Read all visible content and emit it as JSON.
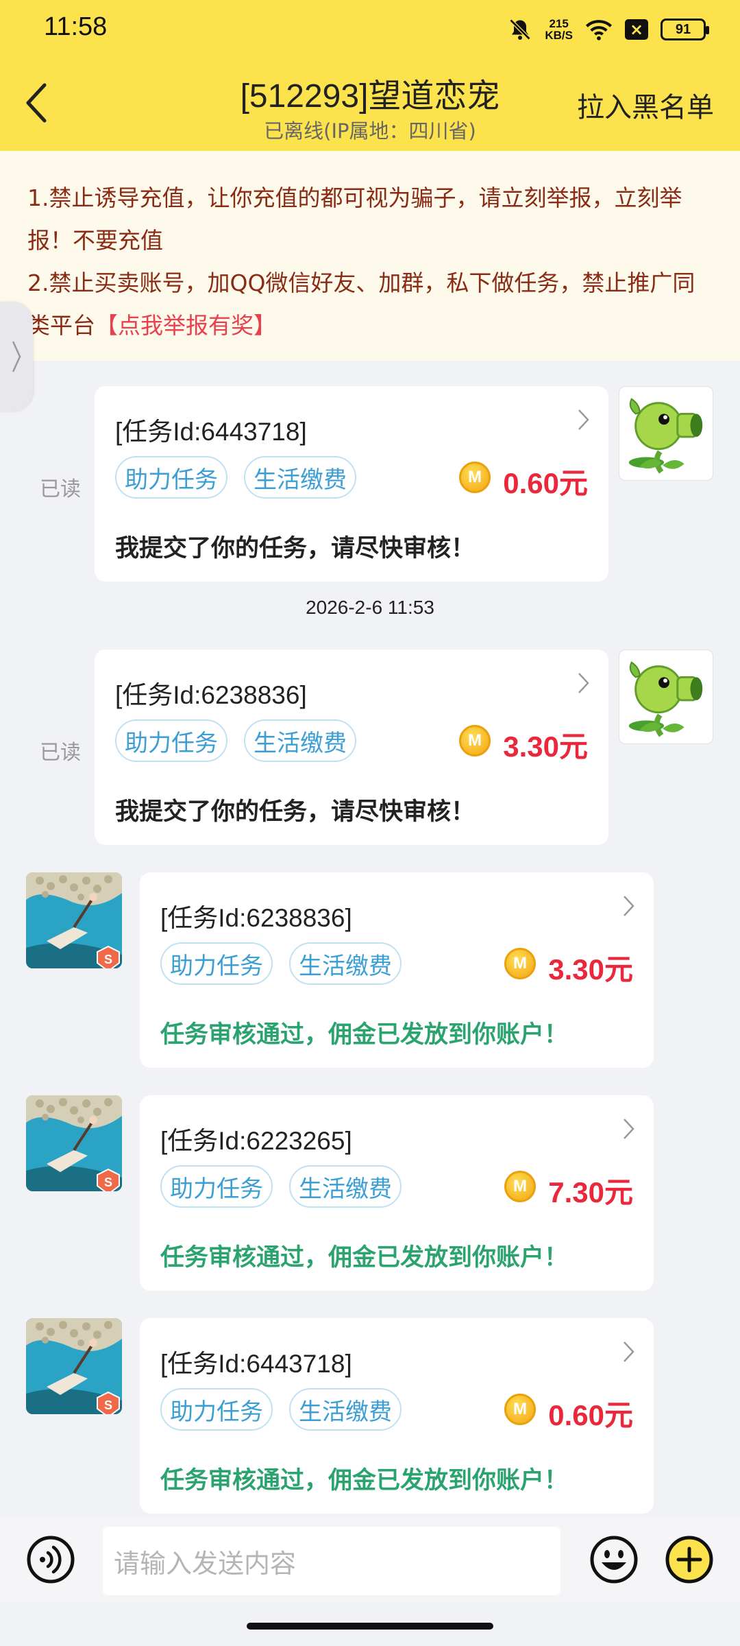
{
  "status_bar": {
    "time": "11:58",
    "net_speed": "215",
    "net_unit": "KB/S",
    "battery": "91"
  },
  "header": {
    "title": "[512293]望道恋宠",
    "subtitle": "已离线(IP属地：四川省)",
    "blacklist_label": "拉入黑名单"
  },
  "notice": {
    "line1": "1.禁止诱导充值，让你充值的都可视为骗子，请立刻举报，立刻举报！不要充值",
    "line2": "2.禁止买卖账号，加QQ微信好友、加群，私下做任务，禁止推广同类平台",
    "report_link": "【点我举报有奖】"
  },
  "timestamp": "2026-2-6 11:53",
  "messages": [
    {
      "side": "right",
      "read": "已读",
      "task_id": "[任务Id:6443718]",
      "tag1": "助力任务",
      "tag2": "生活缴费",
      "coin": "M",
      "amount": "0.60元",
      "text": "我提交了你的任务，请尽快审核！"
    },
    {
      "side": "right",
      "read": "已读",
      "task_id": "[任务Id:6238836]",
      "tag1": "助力任务",
      "tag2": "生活缴费",
      "coin": "M",
      "amount": "3.30元",
      "text": "我提交了你的任务，请尽快审核！"
    },
    {
      "side": "left",
      "task_id": "[任务Id:6238836]",
      "tag1": "助力任务",
      "tag2": "生活缴费",
      "coin": "M",
      "amount": "3.30元",
      "text": "任务审核通过，佣金已发放到你账户！"
    },
    {
      "side": "left",
      "task_id": "[任务Id:6223265]",
      "tag1": "助力任务",
      "tag2": "生活缴费",
      "coin": "M",
      "amount": "7.30元",
      "text": "任务审核通过，佣金已发放到你账户！"
    },
    {
      "side": "left",
      "task_id": "[任务Id:6443718]",
      "tag1": "助力任务",
      "tag2": "生活缴费",
      "coin": "M",
      "amount": "0.60元",
      "text": "任务审核通过，佣金已发放到你账户！"
    }
  ],
  "input": {
    "placeholder": "请输入发送内容"
  },
  "colors": {
    "header_bg": "#fce24c",
    "amount": "#e9283c",
    "tag": "#3b9fd6",
    "approved_text": "#2ba36f",
    "notice_text": "#8a2b16"
  }
}
